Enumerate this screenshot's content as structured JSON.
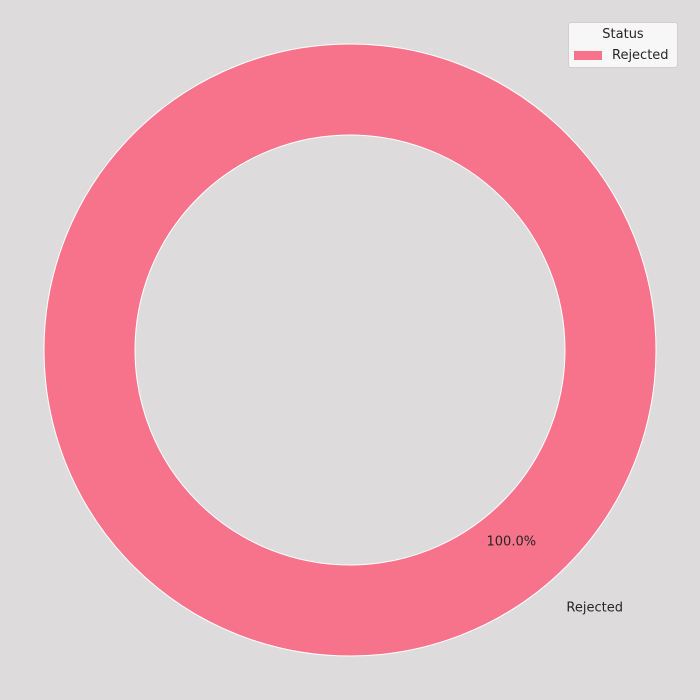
{
  "chart_data": {
    "type": "pie",
    "variant": "donut",
    "categories": [
      "Rejected"
    ],
    "values": [
      100.0
    ],
    "percent_labels": [
      "100.0%"
    ],
    "colors": [
      "#f7738b"
    ],
    "legend": {
      "title": "Status",
      "placement": "top-right",
      "entries": [
        "Rejected"
      ]
    },
    "background_color": "#dedbdc",
    "edge_color": "#ffffff"
  }
}
